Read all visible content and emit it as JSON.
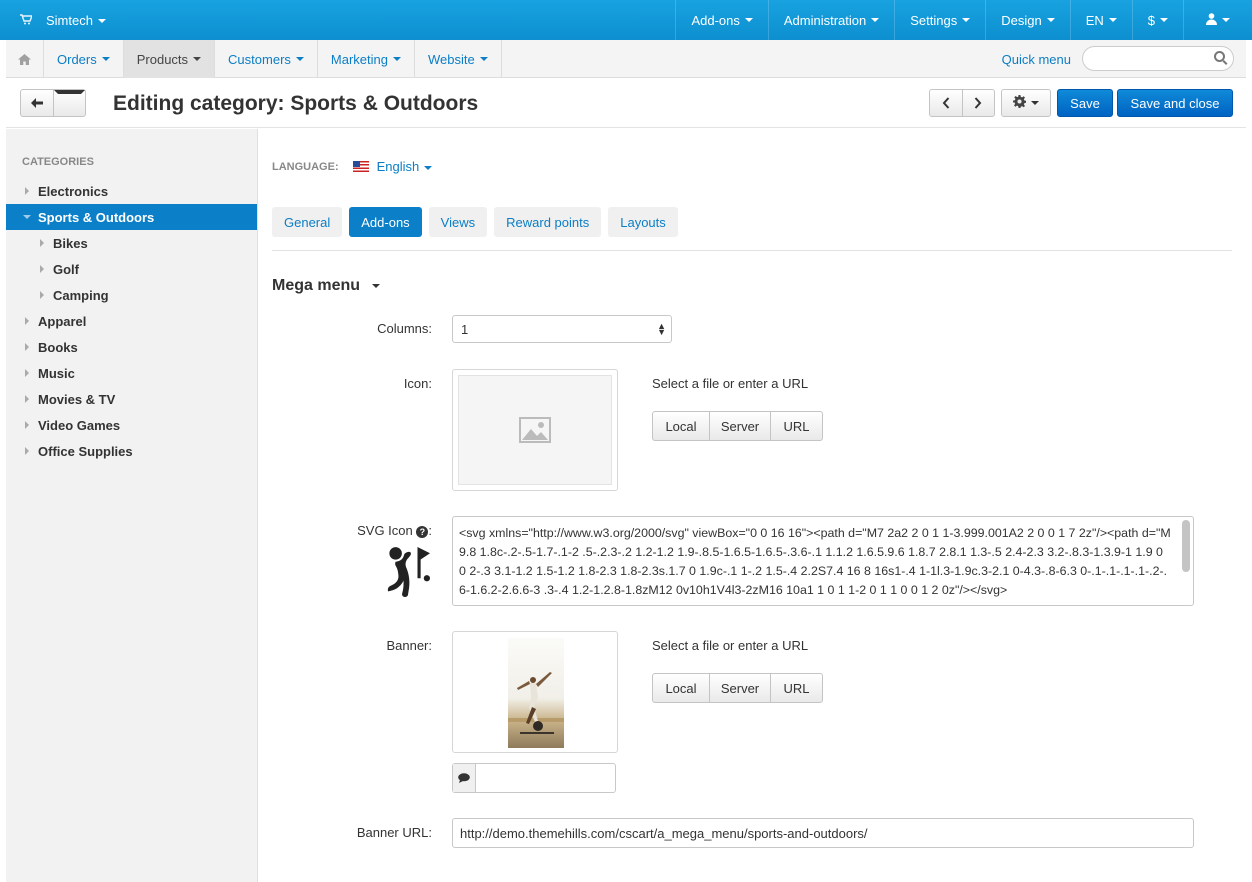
{
  "topbar": {
    "brand": "Simtech",
    "menu": [
      "Add-ons",
      "Administration",
      "Settings",
      "Design",
      "EN",
      "$"
    ],
    "user_icon": "user-icon",
    "cart_icon": "cart-icon"
  },
  "subnav": {
    "items": [
      "Orders",
      "Products",
      "Customers",
      "Marketing",
      "Website"
    ],
    "active": "Products",
    "quick_menu": "Quick menu",
    "search_placeholder": ""
  },
  "titlebar": {
    "title": "Editing category: Sports & Outdoors",
    "save": "Save",
    "save_close": "Save and close"
  },
  "sidebar": {
    "heading": "CATEGORIES",
    "items": [
      {
        "label": "Electronics",
        "level": 0,
        "active": false
      },
      {
        "label": "Sports & Outdoors",
        "level": 0,
        "active": true
      },
      {
        "label": "Bikes",
        "level": 1,
        "active": false
      },
      {
        "label": "Golf",
        "level": 1,
        "active": false
      },
      {
        "label": "Camping",
        "level": 1,
        "active": false
      },
      {
        "label": "Apparel",
        "level": 0,
        "active": false
      },
      {
        "label": "Books",
        "level": 0,
        "active": false
      },
      {
        "label": "Music",
        "level": 0,
        "active": false
      },
      {
        "label": "Movies & TV",
        "level": 0,
        "active": false
      },
      {
        "label": "Video Games",
        "level": 0,
        "active": false
      },
      {
        "label": "Office Supplies",
        "level": 0,
        "active": false
      }
    ]
  },
  "main": {
    "language_label": "LANGUAGE:",
    "language_value": "English",
    "tabs": [
      "General",
      "Add-ons",
      "Views",
      "Reward points",
      "Layouts"
    ],
    "active_tab": "Add-ons",
    "section_title": "Mega menu",
    "columns_label": "Columns:",
    "columns_value": "1",
    "icon_label": "Icon:",
    "select_hint": "Select a file or enter a URL",
    "source_buttons": [
      "Local",
      "Server",
      "URL"
    ],
    "svg_icon_label": "SVG Icon",
    "svg_icon_help": "?",
    "svg_icon_colon": ":",
    "svg_icon_value": "<svg xmlns=\"http://www.w3.org/2000/svg\" viewBox=\"0 0 16 16\"><path d=\"M7 2a2 2 0 1 1-3.999.001A2 2 0 0 1 7 2z\"/><path d=\"M9.8 1.8c-.2-.5-1.7-.1-2 .5-.2.3-.2 1.2-1.2 1.9-.8.5-1.6.5-1.6.5-.3.6-.1 1.1.2 1.6.5.9.6 1.8.7 2.8.1 1.3-.5 2.4-2.3 3.2-.8.3-1.3.9-1 1.9 0 0 2-.3 3.1-1.2 1.5-1.2 1.8-2.3 1.8-2.3s.1.7 0 1.9c-.1 1-.2 1.5-.4 2.2S7.4 16 8 16s1-.4 1-1l.3-1.9c.3-2.1 0-4.3-.8-6.3 0-.1-.1-.1-.1-.2-.6-1.6.2-2.6.6-3 .3-.4 1.2-1.2.8-1.8zM12 0v10h1V4l3-2zM16 10a1 1 0 1 1-2 0 1 1 0 0 1 2 0z\"/></svg>",
    "banner_label": "Banner:",
    "banner_alt_value": "",
    "banner_url_label": "Banner URL:",
    "banner_url_value": "http://demo.themehills.com/cscart/a_mega_menu/sports-and-outdoors/"
  },
  "colors": {
    "topbar": "#0d8fd0",
    "primary_button": "#0063c3",
    "link": "#0b7ec5",
    "active_item": "#0b80c8"
  }
}
